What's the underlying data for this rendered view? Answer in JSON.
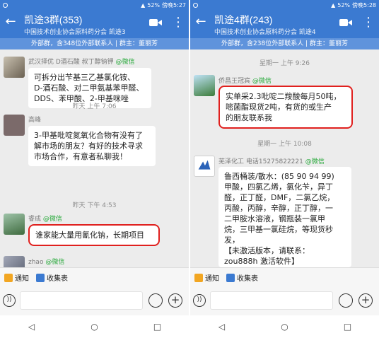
{
  "left": {
    "status": {
      "carrier_icons": "bt-wifi-signal",
      "battery": "52%",
      "time": "傍晚5:27"
    },
    "title": "凯途3群(353)",
    "subtitle": "中国技术创业协会原料药分会 凯途3",
    "banner": "外部群，含348位外部联系人 | 群主：董丽芳",
    "messages": [
      {
        "sender": "武汉择优 D酒石酸 叔丁醇钠钾",
        "wx": "@微信",
        "text": "可拆分出苄基三乙基氯化铵、\nD-酒石酸、对二甲氨基苯甲醛、\nDDS、苯甲酸、2-甲基咪唑"
      },
      {
        "time": "昨天 上午 7:06"
      },
      {
        "sender": "高峰",
        "wx": "",
        "text": "3-甲基吡啶氮氧化合物有没有了\n解市场的朋友？有好的技术寻求\n市场合作，有意者私聊我！"
      },
      {
        "time": "昨天 下午 4:53"
      },
      {
        "sender": "睿成",
        "wx": "@微信",
        "text": "谁家能大量用氰化钠，长期项目"
      },
      {
        "sender": "zhao",
        "wx": "@微信",
        "text": ""
      }
    ],
    "tools": [
      "通知",
      "收集表"
    ]
  },
  "right": {
    "status": {
      "carrier_icons": "bt-wifi-signal",
      "battery": "52%",
      "time": "傍晚5:28"
    },
    "title": "凯途4群(243)",
    "subtitle": "中国技术创业协会原料药分会 凯途4",
    "banner": "外部群，含238位外部联系人 | 群主：董丽芳",
    "messages": [
      {
        "time": "星期一 上午 9:26"
      },
      {
        "sender": "侨昌王冠宾",
        "wx": "@微信",
        "text": "实单采2.3吡啶二羧酸每月50吨，\n嘧菌酯现货2吨，有货的或生产\n的朋友联系我"
      },
      {
        "time": "星期一 上午 10:08"
      },
      {
        "sender": "芜泽化工 电话15275822221",
        "wx": "@微信",
        "text": "鲁西桶装/散水：(85 90 94 99)\n甲酸，四氯乙烯，氯化苄，异丁\n醛，正丁醛，DMF，二氯乙烷，\n丙酸，丙醇，辛醇，正丁醇，一\n二甲胺水溶液，钢瓶装一氯甲\n烷，三甲基一氯硅烷，等现货秒\n发，\n【未激活版本，请联系：\nzou888h 激活软件】"
      }
    ],
    "tools": [
      "通知",
      "收集表"
    ]
  },
  "colors": {
    "appbar": "#3b7ad1",
    "banner": "#5f93dc",
    "highlight": "#e0201e",
    "wechat_green": "#27a93a"
  },
  "icons": [
    "back-arrow-icon",
    "video-call-icon",
    "more-vert-icon",
    "voice-icon",
    "emoji-icon",
    "plus-icon",
    "nav-back-icon",
    "nav-home-icon",
    "nav-recents-icon"
  ]
}
